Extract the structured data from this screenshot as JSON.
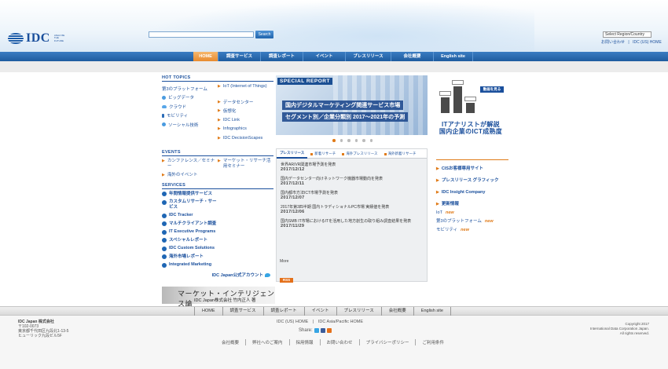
{
  "header": {
    "logo_text": "IDC",
    "logo_tagline": "ANALYZE THE FUTURE",
    "search_button": "Search",
    "region_select": "Select Region/Country",
    "top_links": [
      "お問い合わせ",
      "IDC (US) HOME"
    ]
  },
  "nav": {
    "items": [
      "HOME",
      "調査サービス",
      "調査レポート",
      "イベント",
      "プレスリリース",
      "会社概要",
      "English site"
    ]
  },
  "hot_topics": {
    "title": "HOT TOPICS",
    "left": [
      "第3のプラットフォーム",
      "ビッグデータ",
      "クラウド",
      "モビリティ",
      "ソーシャル技術"
    ],
    "right": [
      "IoT (Internet of Things)",
      "データセンター",
      "仮想化",
      "IDC Link",
      "Infographics",
      "IDC DecisionScapes"
    ]
  },
  "events": {
    "title": "EVENTS",
    "items": [
      "カンファレンス／セミナー",
      "マーケット・リサーチ活用セミナー",
      "海外のイベント"
    ]
  },
  "services": {
    "title": "SERVICES",
    "items": [
      "年間情報提供サービス",
      "カスタムリサーチ・サービス",
      "IDC Tracker",
      "マルチクライアント調査",
      "IT Executive Programs",
      "スペシャルレポート",
      "IDC Custom Solutions",
      "海外市場レポート",
      "Integrated Marketing"
    ],
    "twitter": "IDC Japan公式アカウント"
  },
  "mi_banner": {
    "title": "マーケット・インテリジェンス論",
    "subtitle": "IDC Japan株式会社 竹内正人 著"
  },
  "special_report": {
    "label": "SPECIAL REPORT",
    "line1": "国内デジタルマーケティング関連サービス市場",
    "line2": "セグメント別／企業分類別 2017～2021年の予測"
  },
  "news": {
    "tabs": [
      "プレスリリース",
      "新着リサーチ",
      "海外プレスリリース",
      "海外新着リサーチ"
    ],
    "items": [
      {
        "title": "世界AR/VR関連市場予測を発表",
        "date": "2017/12/12"
      },
      {
        "title": "国内データセンター向けネットワーク機器市場動向を発表",
        "date": "2017/12/11"
      },
      {
        "title": "国内都市方法ICT市場予測を発表",
        "date": "2017/12/07"
      },
      {
        "title": "2017年第3四半期 国内トラディショナルPC市場 実績値を発表",
        "date": "2017/12/06"
      },
      {
        "title": "国内SMB IT市場におけるITを活用した地方創生の取り組み調査結果を発表",
        "date": "2017/11/29"
      }
    ],
    "more": "More",
    "rss": "RSS"
  },
  "ad": {
    "video_label": "動画を見る",
    "line1": "ITアナリストが解説",
    "line2": "国内企業のICT成熟度",
    "bar_levels": [
      0.55,
      0.95,
      0.35
    ]
  },
  "right_links": {
    "items": [
      "CISお客様専用サイト",
      "プレスリリース グラフィック",
      "IDC Insight Company",
      "更新情報"
    ],
    "updates": [
      "IoT",
      "第3のプラットフォーム",
      "モビリティ"
    ],
    "new_label": "new"
  },
  "footer": {
    "nav": [
      "HOME",
      "調査サービス",
      "調査レポート",
      "イベント",
      "プレスリリース",
      "会社概要",
      "English site"
    ],
    "company": [
      "IDC Japan 株式会社",
      "〒102-0073",
      "東京都千代田区九段北1-13-5",
      "ヒューリック九段ビル5F"
    ],
    "links": [
      "IDC (US) HOME",
      "IDC Asia/Pacific HOME"
    ],
    "share": "Share:",
    "copyright": [
      "Copyright 2017",
      "International Data Corporation Japan.",
      "All rights reserved."
    ],
    "bottom": [
      "会社概要",
      "弊社ヘのご案内",
      "採用情報",
      "お問い合わせ",
      "プライバシーポリシー",
      "ご利用条件"
    ]
  },
  "colors": {
    "brand_blue": "#1a4f9c",
    "nav_blue": "#2b6db3",
    "accent_orange": "#e07a17"
  }
}
